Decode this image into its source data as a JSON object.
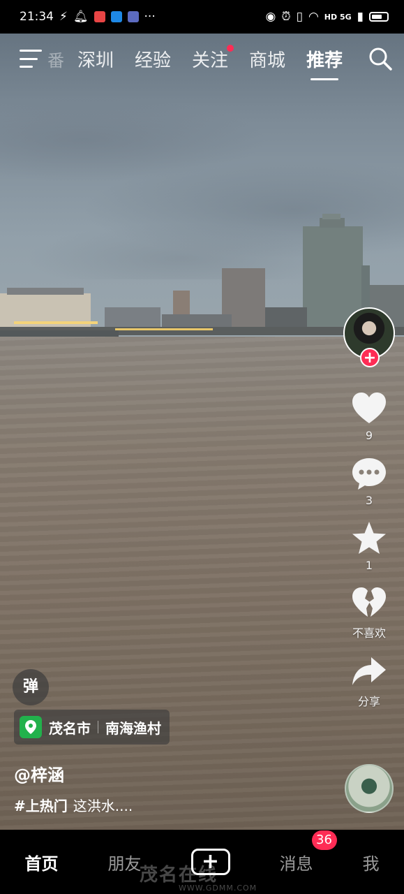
{
  "status_bar": {
    "time": "21:34",
    "more": "···",
    "network": "HD 5G",
    "app_icon_colors": [
      "#e84545",
      "#1e88e5",
      "#5c6bc0"
    ]
  },
  "top_nav": {
    "faded_tab": "番",
    "tabs": [
      {
        "label": "深圳",
        "active": false,
        "dot": false
      },
      {
        "label": "经验",
        "active": false,
        "dot": false
      },
      {
        "label": "关注",
        "active": false,
        "dot": true
      },
      {
        "label": "商城",
        "active": false,
        "dot": false
      },
      {
        "label": "推荐",
        "active": true,
        "dot": false
      }
    ]
  },
  "actions": {
    "follow_symbol": "+",
    "like_count": "9",
    "comment_count": "3",
    "favorite_count": "1",
    "dislike_label": "不喜欢",
    "share_label": "分享"
  },
  "video": {
    "danmu_label": "弹",
    "location_city": "茂名市",
    "location_place": "南海渔村",
    "author": "@梓涵",
    "hashtag": "#上热门",
    "caption": "这洪水...."
  },
  "bottom_tabs": {
    "home": "首页",
    "friends": "朋友",
    "create": "+",
    "messages": "消息",
    "messages_badge": "36",
    "me": "我"
  },
  "watermark": {
    "text": "茂名在线",
    "url": "WWW.GDMM.COM"
  },
  "colors": {
    "accent": "#fe2c55",
    "location_green": "#22b14c",
    "water": "#7d7063",
    "sky": "#7d8b97"
  }
}
